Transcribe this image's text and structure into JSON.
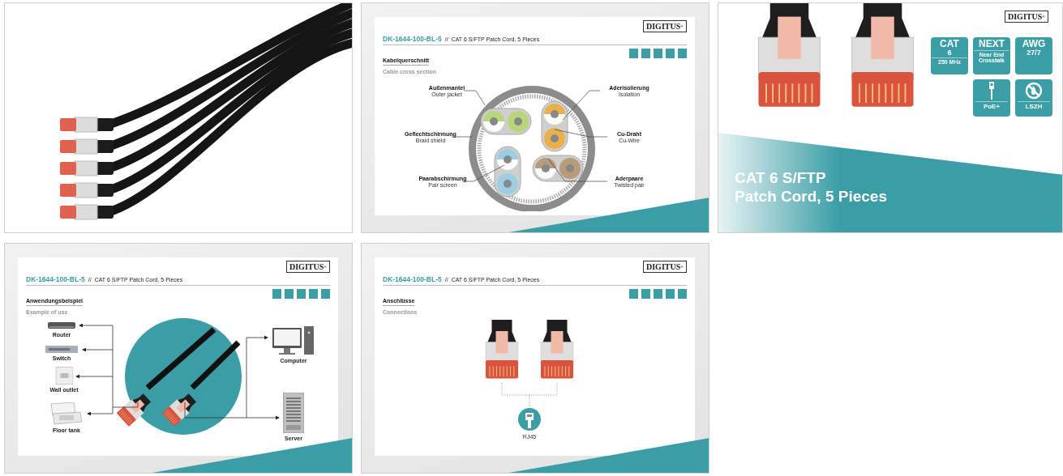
{
  "tiles": [
    {
      "kind": "photo"
    },
    {
      "kind": "slide",
      "logo": "DIGITUS$^{®}$",
      "code": "DK-1644-100-BL-5",
      "separator": "//",
      "product": "CAT 6 S/FTP Patch Cord, 5 Pieces",
      "heading": "Kabelquerschnitt",
      "subheading": "Cable cross section",
      "diagram": {
        "kind": "cross_section",
        "labels": [
          {
            "de": "Außenmantel",
            "en": "Outer jacket"
          },
          {
            "de": "Aderisolierung",
            "en": "Isolation"
          },
          {
            "de": "Geflechtschirmung",
            "en": "Braid shield"
          },
          {
            "de": "Cu-Draht",
            "en": "Cu-Wire"
          },
          {
            "de": "Paarabschirmung",
            "en": "Pair screen"
          },
          {
            "de": "Aderpaare",
            "en": "Twisted pair"
          }
        ]
      }
    },
    {
      "kind": "hero",
      "logo": "DIGITUS$^{®}$",
      "badges": [
        {
          "kind": "spec",
          "title": "CAT",
          "value": "6",
          "note": "250 MHz"
        },
        {
          "kind": "spec",
          "title": "NEXT",
          "note": "Near End Crosstalk"
        },
        {
          "kind": "spec",
          "title": "AWG",
          "value": "27/7"
        },
        {
          "kind": "poe",
          "caption": "PoE+"
        },
        {
          "kind": "lszh",
          "caption": "LSZH"
        }
      ],
      "title": [
        "CAT 6 S/FTP",
        "Patch Cord, 5 Pieces"
      ]
    },
    {
      "kind": "slide",
      "logo": "DIGITUS$^{®}$",
      "code": "DK-1644-100-BL-5",
      "separator": "//",
      "product": "CAT 6 S/FTP Patch Cord, 5 Pieces",
      "heading": "Anwendungsbeispiel",
      "subheading": "Example of use",
      "diagram": {
        "kind": "use",
        "devices": [
          {
            "kind": "router",
            "label": "Router"
          },
          {
            "kind": "switch",
            "label": "Switch"
          },
          {
            "kind": "outlet",
            "label": "Wall outlet"
          },
          {
            "kind": "floortank",
            "label": "Floor tank"
          },
          {
            "kind": "computer",
            "label": "Computer"
          },
          {
            "kind": "server",
            "label": "Server"
          }
        ]
      }
    },
    {
      "kind": "slide",
      "logo": "DIGITUS$^{®}$",
      "code": "DK-1644-100-BL-5",
      "separator": "//",
      "product": "CAT 6 S/FTP Patch Cord, 5 Pieces",
      "heading": "Anschlüsse",
      "subheading": "Connections",
      "diagram": {
        "kind": "connections",
        "label": "RJ45"
      }
    }
  ]
}
